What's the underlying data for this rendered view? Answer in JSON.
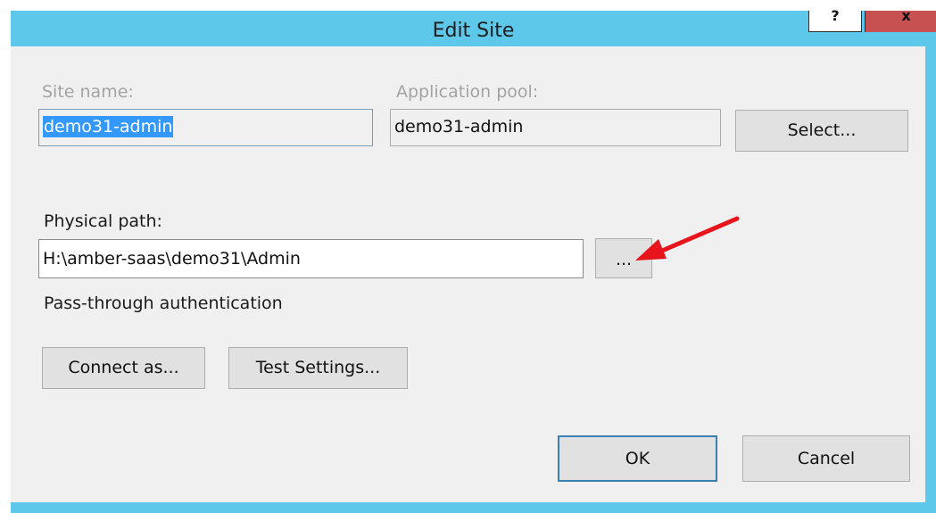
{
  "dialog": {
    "title": "Edit Site",
    "help_glyph": "?",
    "close_glyph": "x"
  },
  "site_name": {
    "label": "Site name:",
    "value": "demo31-admin"
  },
  "application_pool": {
    "label": "Application pool:",
    "value": "demo31-admin",
    "select_button": "Select..."
  },
  "physical_path": {
    "label": "Physical path:",
    "value": "H:\\amber-saas\\demo31\\Admin",
    "browse_button": "..."
  },
  "authentication": {
    "text": "Pass-through authentication",
    "connect_as_button": "Connect as...",
    "test_settings_button": "Test Settings..."
  },
  "footer": {
    "ok_button": "OK",
    "cancel_button": "Cancel"
  },
  "colors": {
    "titlebar": "#5ec8ea",
    "close_button": "#c75050",
    "selection": "#3399ff",
    "annotation_arrow": "#e8141b"
  },
  "annotation": {
    "icon": "red-arrow-pointing-at-browse-button"
  }
}
